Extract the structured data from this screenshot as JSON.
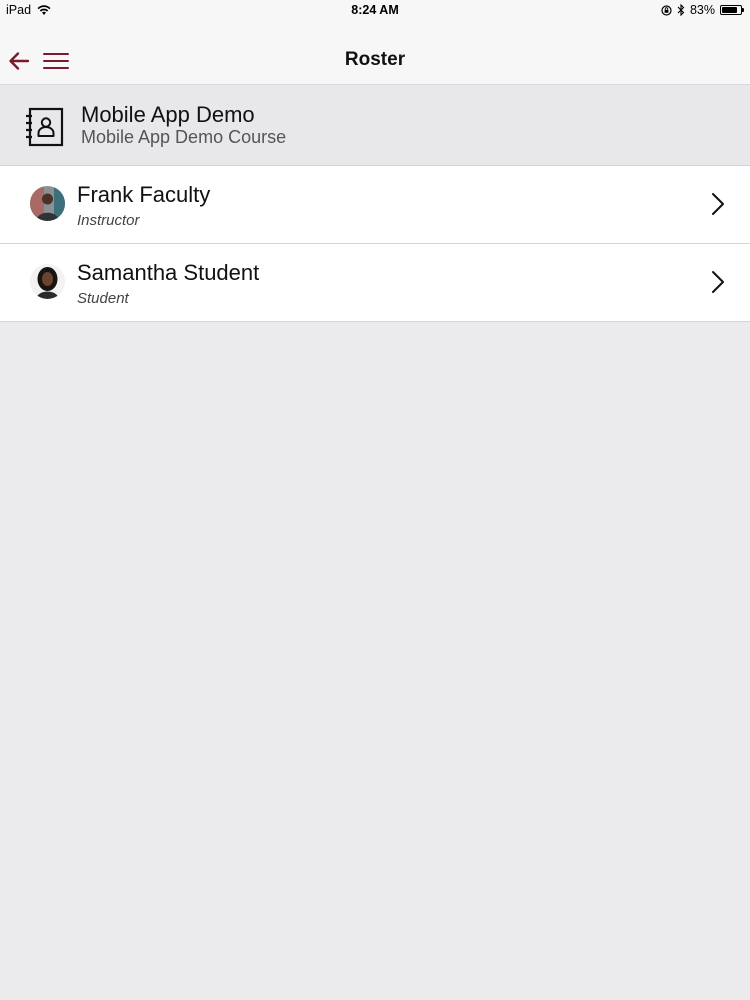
{
  "status_bar": {
    "device": "iPad",
    "time": "8:24 AM",
    "battery_percent": "83%",
    "battery_level": 0.83,
    "icons": [
      "wifi-icon",
      "orientation-lock-icon",
      "bluetooth-icon",
      "battery-icon"
    ]
  },
  "nav": {
    "title": "Roster",
    "back_icon": "back-arrow-icon",
    "menu_icon": "hamburger-menu-icon"
  },
  "course": {
    "icon": "contact-book-icon",
    "title": "Mobile App Demo",
    "subtitle": "Mobile App Demo Course"
  },
  "roster": [
    {
      "name": "Frank Faculty",
      "role": "Instructor"
    },
    {
      "name": "Samantha Student",
      "role": "Student"
    }
  ],
  "colors": {
    "accent": "#7a1a2e",
    "background": "#ebeaed",
    "nav_background": "#f7f7f7",
    "row_background": "#ffffff"
  }
}
